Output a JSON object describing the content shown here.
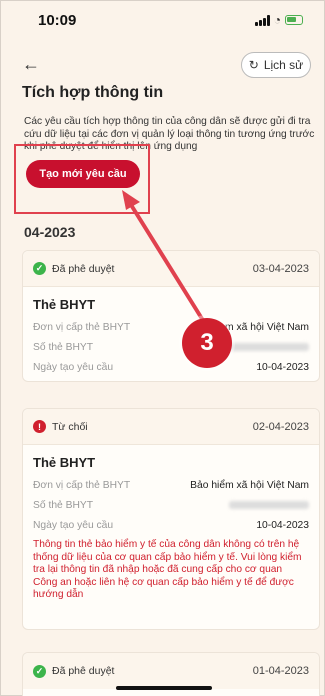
{
  "status_bar": {
    "time": "10:09"
  },
  "header": {
    "back_icon": "arrow-left-icon",
    "history_label": "Lịch sử",
    "title": "Tích hợp thông tin"
  },
  "intro": "Các yêu cầu tích hợp thông tin của công dân sẽ được gửi đi tra cứu dữ liệu tại các đơn vị quản lý loại thông tin tương ứng trước khi phê duyệt để hiển thị lên ứng dụng",
  "create_button": "Tạo mới yêu cầu",
  "month": "04-2023",
  "annotation": {
    "number": "3",
    "color": "#d0202e"
  },
  "cards": [
    {
      "status": "Đã phê duyệt",
      "status_type": "approved",
      "date": "03-04-2023",
      "title": "Thẻ BHYT",
      "rows": [
        {
          "label": "Đơn vị cấp thẻ BHYT",
          "value": "...m xã hội Việt Nam"
        },
        {
          "label": "Số thẻ BHYT",
          "value": ""
        },
        {
          "label": "Ngày tạo yêu cầu",
          "value": "10-04-2023"
        }
      ]
    },
    {
      "status": "Từ chối",
      "status_type": "rejected",
      "date": "02-04-2023",
      "title": "Thẻ BHYT",
      "rows": [
        {
          "label": "Đơn vị cấp thẻ BHYT",
          "value": "Bảo hiểm xã hội Việt Nam"
        },
        {
          "label": "Số thẻ BHYT",
          "value": ""
        },
        {
          "label": "Ngày tạo yêu cầu",
          "value": "10-04-2023"
        }
      ],
      "reject_reason": "Thông tin thẻ bảo hiểm y tế của công dân không có trên hệ thống dữ liệu của cơ quan cấp bảo hiểm y tế. Vui lòng kiểm tra lại thông tin đã nhập hoặc đã cung cấp cho cơ quan Công an hoặc liên hệ cơ quan cấp bảo hiểm y tế để được hướng dẫn"
    },
    {
      "status": "Đã phê duyệt",
      "status_type": "approved",
      "date": "01-04-2023"
    }
  ],
  "colors": {
    "accent": "#c8102e",
    "approved": "#3cb44b",
    "rejected": "#d0202e",
    "background": "#fbf3ea"
  }
}
